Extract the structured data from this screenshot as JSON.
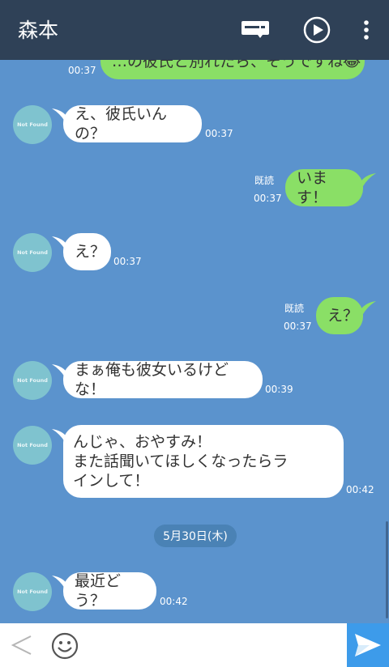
{
  "header": {
    "title": "森本"
  },
  "avatar_label": "Not Found",
  "date_separator": "5月30日(木)",
  "messages": [
    {
      "side": "right",
      "text": "…の彼氏と別れたら、そうですね😂",
      "time": "00:37"
    },
    {
      "side": "left",
      "text": "え、彼氏いんの？",
      "time": "00:37"
    },
    {
      "side": "right",
      "text": "います！",
      "time": "00:37",
      "read": "既読"
    },
    {
      "side": "left",
      "text": "え？",
      "time": "00:37"
    },
    {
      "side": "right",
      "text": "え？",
      "time": "00:37",
      "read": "既読"
    },
    {
      "side": "left",
      "text": "まぁ俺も彼女いるけどな！",
      "time": "00:39"
    },
    {
      "side": "left",
      "lines": [
        "んじゃ、おやすみ！",
        "また話聞いてほしくなったらラ",
        "インして！"
      ],
      "time": "00:42"
    },
    {
      "side": "left",
      "text": "最近どう？",
      "time": "00:42"
    }
  ],
  "colors": {
    "chat_background": "#5b93cd",
    "header": "#2f4157",
    "incoming_bubble": "#ffffff",
    "outgoing_bubble": "#8adf66",
    "send_button": "#3d9bea"
  },
  "icons": {
    "header": [
      "keyboard-icon",
      "play-icon",
      "more-vertical-icon"
    ],
    "footer": [
      "back-arrow-icon",
      "emoji-icon",
      "send-icon"
    ]
  }
}
